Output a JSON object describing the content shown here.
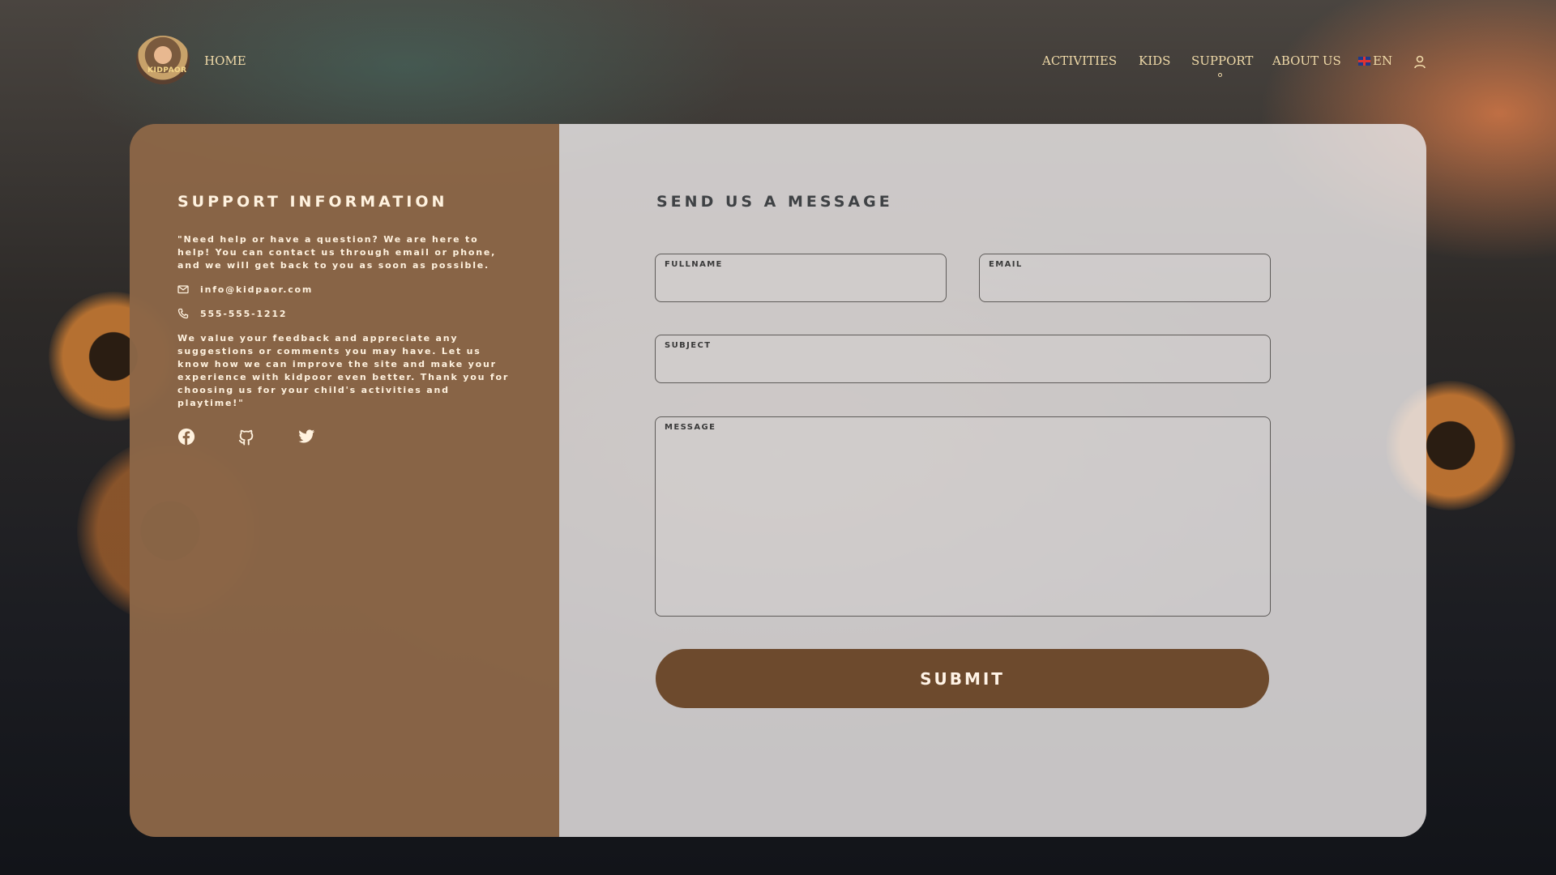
{
  "nav": {
    "logo_text": "KIDPAOR",
    "home": "HOME",
    "activities": "ACTIVITIES",
    "kids": "KIDS",
    "support": "SUPPORT",
    "about": "ABOUT US",
    "language": "EN",
    "active_item": "SUPPORT"
  },
  "support_info": {
    "title": "SUPPORT INFORMATION",
    "intro": "\"Need help or have a question? We are here to help! You can contact us through email or phone, and we will get back to you as soon as possible.",
    "email": "info@kidpaor.com",
    "phone": "555-555-1212",
    "feedback": "We value your feedback and appreciate any suggestions or comments you may have. Let us know how we can improve the site and make your experience with kidpoor even better. Thank you for choosing us for your child's activities and playtime!\"",
    "socials": [
      "facebook-icon",
      "github-icon",
      "twitter-icon"
    ]
  },
  "form": {
    "title": "SEND US A MESSAGE",
    "fullname_label": "FULLNAME",
    "fullname_value": "",
    "email_label": "EMAIL",
    "email_value": "",
    "subject_label": "SUBJECT",
    "subject_value": "",
    "message_label": "MESSAGE",
    "message_value": "",
    "submit_label": "SUBMIT"
  },
  "colors": {
    "left_panel": "#8b6647",
    "right_panel": "#e8e5e5",
    "submit_bg": "#6d4a2d",
    "nav_text": "#efd9a8"
  }
}
